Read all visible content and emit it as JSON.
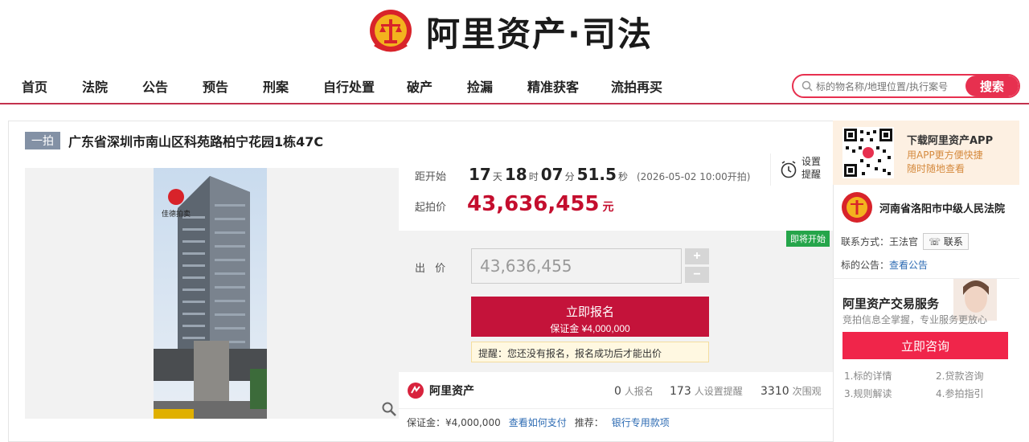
{
  "header": {
    "brand": "阿里资产·司法"
  },
  "nav": {
    "items": [
      "首页",
      "法院",
      "公告",
      "预告",
      "刑案",
      "自行处置",
      "破产",
      "捡漏",
      "精准获客",
      "流拍再买"
    ]
  },
  "search": {
    "placeholder": "标的物名称/地理位置/执行案号",
    "button": "搜索"
  },
  "item": {
    "tag": "一拍",
    "title": "广东省深圳市南山区科苑路柏宁花园1栋47C",
    "countdown_label": "距开始",
    "days": "17",
    "days_unit": "天",
    "hours": "18",
    "hours_unit": "时",
    "minutes": "07",
    "minutes_unit": "分",
    "seconds": "51.5",
    "seconds_unit": "秒",
    "start_time": "(2026-05-02 10:00开拍)",
    "reminder": "设置提醒",
    "price_label": "起拍价",
    "price": "43,636,455",
    "price_unit": "元",
    "photo_watermark": "佳德拍卖"
  },
  "bid": {
    "badge": "即将开始",
    "label": "出 价",
    "value": "43,636,455",
    "plus": "+",
    "minus": "−",
    "register_label": "立即报名",
    "register_deposit": "保证金 ¥4,000,000",
    "notice": "提醒：您还没有报名，报名成功后才能出价"
  },
  "stats": {
    "logo_text": "阿里资产",
    "signups": "0",
    "signups_label": "人报名",
    "reminders": "173",
    "reminders_label": "人设置提醒",
    "views": "3310",
    "views_label": "次围观"
  },
  "deposit": {
    "label": "保证金：¥4,000,000",
    "how_to_pay": "查看如何支付",
    "recommend": "推荐：",
    "bank": "银行专用款项"
  },
  "sidebar": {
    "app_title": "下载阿里资产APP",
    "app_sub1": "用APP更方便快捷",
    "app_sub2": "随时随地查看",
    "court": "河南省洛阳市中级人民法院",
    "contact_label": "联系方式：王法官",
    "contact_btn": "联系",
    "announce_label": "标的公告：",
    "announce_link": "查看公告",
    "service_title": "阿里资产交易服务",
    "service_sub": "竞拍信息全掌握，专业服务更放心",
    "consult": "立即咨询",
    "links": [
      "1.标的详情",
      "2.贷款咨询",
      "3.规则解读",
      "4.参拍指引"
    ]
  },
  "colors": {
    "accent": "#c40e2e",
    "nav_line": "#c3324d",
    "search": "#e7304f",
    "badge_green": "#25a54a"
  }
}
